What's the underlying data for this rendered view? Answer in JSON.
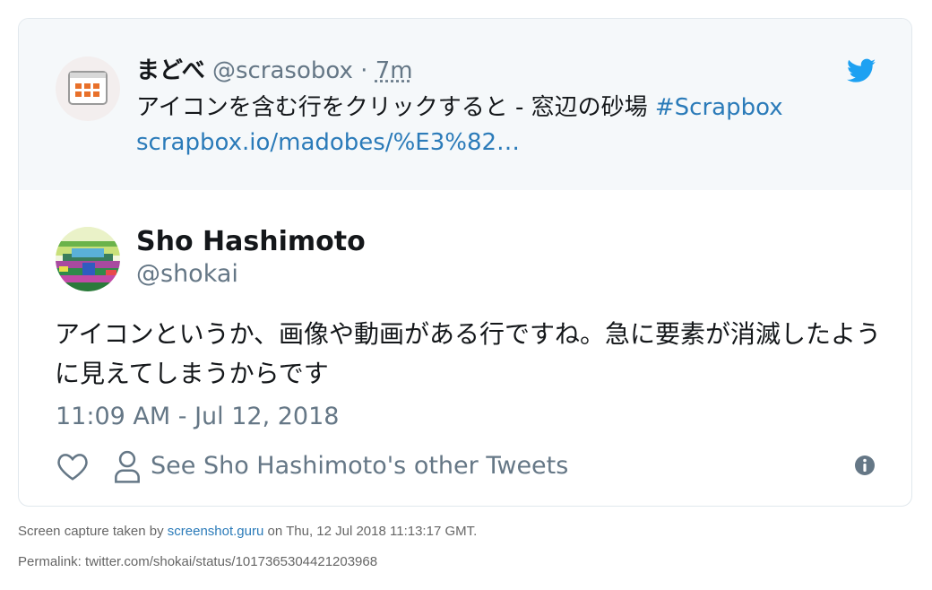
{
  "quoted_tweet": {
    "name": "まどべ",
    "handle": "@scrasobox",
    "separator": "·",
    "time": "7m",
    "text": "アイコンを含む行をクリックすると - 窓辺の砂場 ",
    "hashtag": "#Scrapbox",
    "link": "scrapbox.io/madobes/%E3%82…",
    "avatar_icon": "calendar-grid-icon",
    "accent_color": "#e8702a"
  },
  "tweet": {
    "author_name": "Sho Hashimoto",
    "author_handle": "@shokai",
    "text": "アイコンというか、画像や動画がある行ですね。急に要素が消滅したように見えてしまうからです",
    "timestamp": "11:09 AM - Jul 12, 2018",
    "see_other_label": "See Sho Hashimoto's other Tweets"
  },
  "brand": {
    "twitter_blue": "#1da1f2",
    "link_color": "#2b7bb9"
  },
  "footer": {
    "capture_prefix": "Screen capture taken by ",
    "capture_link": "screenshot.guru",
    "capture_suffix": " on Thu, 12 Jul 2018 11:13:17 GMT.",
    "permalink": "Permalink: twitter.com/shokai/status/1017365304421203968"
  }
}
